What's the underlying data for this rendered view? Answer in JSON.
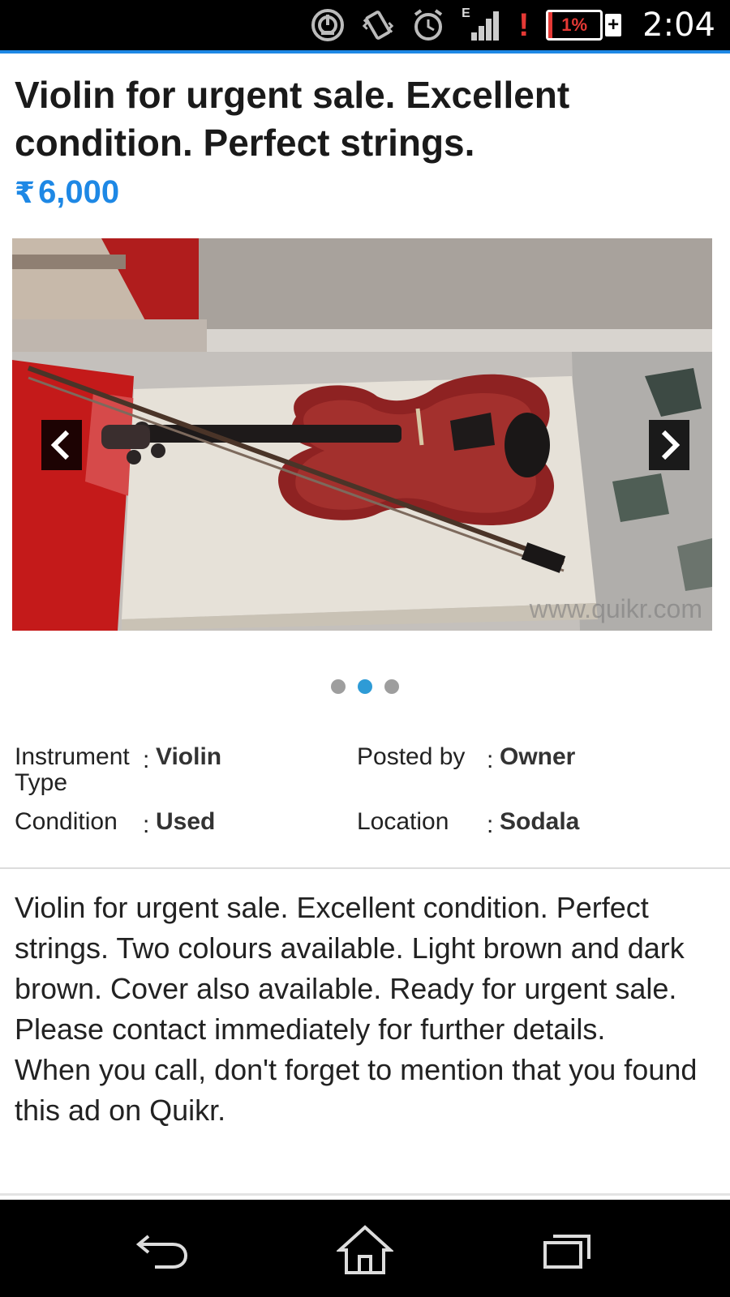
{
  "status_bar": {
    "time": "2:04",
    "battery_text": "1%",
    "battery_plus": "+",
    "network_label": "E",
    "icons": [
      "speedometer-icon",
      "vibrate-icon",
      "alarm-clock-icon",
      "signal-icon",
      "battery-icon"
    ],
    "accent_color": "#1e88e5"
  },
  "ad": {
    "title": "Violin for urgent sale. Excellent condition. Perfect strings.",
    "currency_symbol": "₹",
    "price": "6,000",
    "price_color": "#1e88e5"
  },
  "gallery": {
    "watermark": "www.quikr.com",
    "slide_count": 3,
    "active_slide": 2
  },
  "specs": {
    "instrument_type": {
      "label_line1": "Instrument",
      "label_line2": "Type",
      "colon": ":",
      "value": "Violin"
    },
    "posted_by": {
      "label": "Posted by",
      "colon": ":",
      "value": "Owner"
    },
    "condition": {
      "label": "Condition",
      "colon": ":",
      "value": "Used"
    },
    "location": {
      "label": "Location",
      "colon": ":",
      "value": "Sodala"
    }
  },
  "description": {
    "paragraph1": "Violin for urgent sale. Excellent condition. Perfect strings. Two colours available. Light brown and dark brown. Cover also available. Ready for urgent sale. Please contact immediately for further details.",
    "paragraph2": "When you call, don't forget to mention that you found this ad on Quikr."
  },
  "nav_bar": {
    "buttons": [
      "back-icon",
      "home-icon",
      "recent-apps-icon"
    ]
  }
}
